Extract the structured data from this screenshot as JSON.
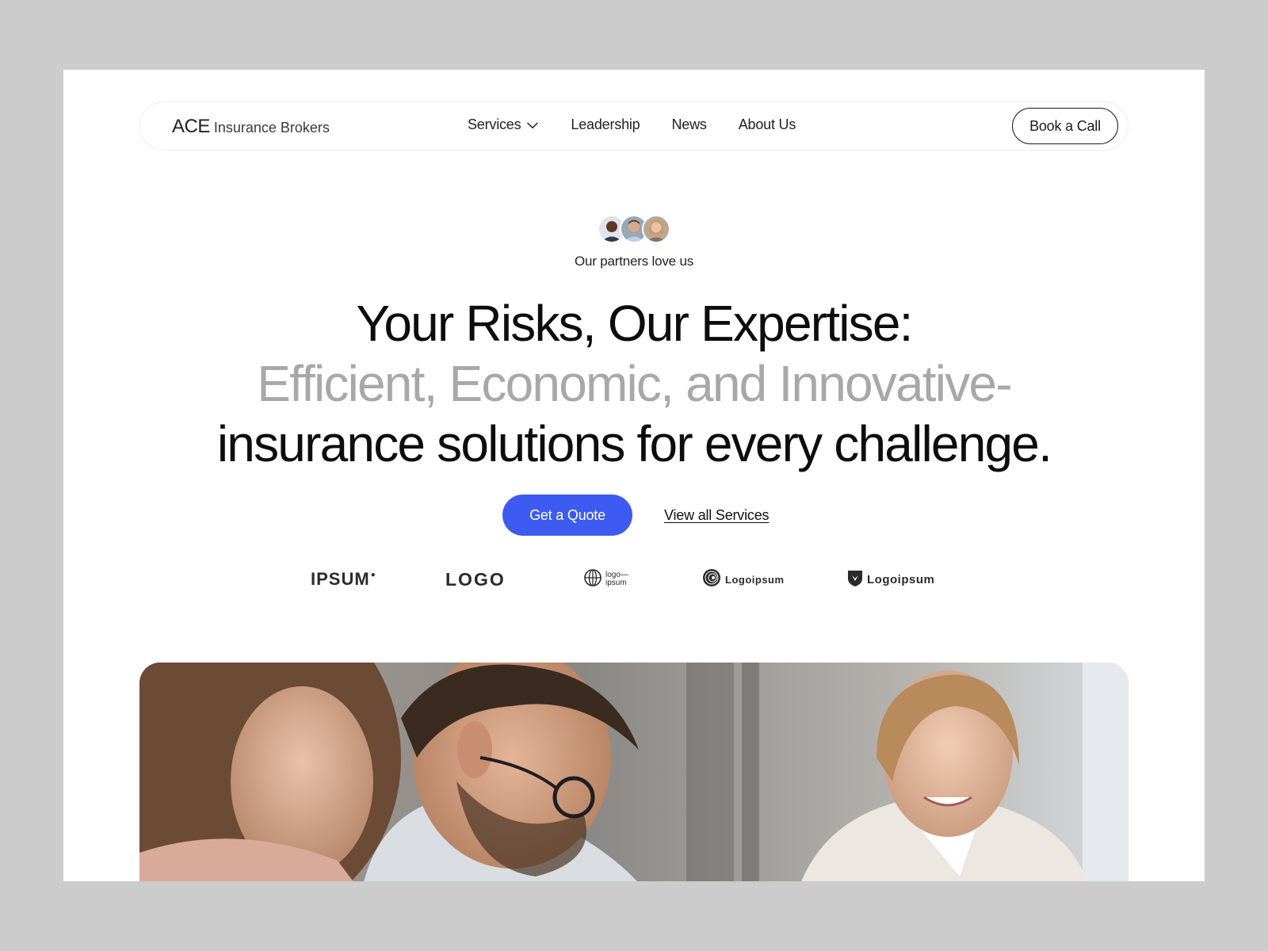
{
  "nav": {
    "brand_strong": "ACE",
    "brand_light": "Insurance Brokers",
    "links": [
      {
        "label": "Services",
        "has_dropdown": true
      },
      {
        "label": "Leadership"
      },
      {
        "label": "News"
      },
      {
        "label": "About Us"
      }
    ],
    "cta_label": "Book a Call"
  },
  "hero": {
    "partners_text": "Our partners love us",
    "headline_line1": "Your Risks, Our Expertise:",
    "headline_line2": "Efficient, Economic, and Innovative-",
    "headline_line3": "insurance solutions for every challenge.",
    "primary_cta": "Get a Quote",
    "secondary_cta": "View all Services"
  },
  "logos": [
    {
      "text": "IPSUM"
    },
    {
      "text": "LOGO"
    },
    {
      "text": "logo— ipsum",
      "line1": "logo—",
      "line2": "ipsum"
    },
    {
      "text": "Logoipsum"
    },
    {
      "text": "Logoipsum"
    }
  ],
  "colors": {
    "accent": "#3d5af1",
    "headline_muted": "#a8a8a8",
    "backdrop": "#cccccc"
  },
  "icons": {
    "dropdown": "chevron-down-icon"
  }
}
